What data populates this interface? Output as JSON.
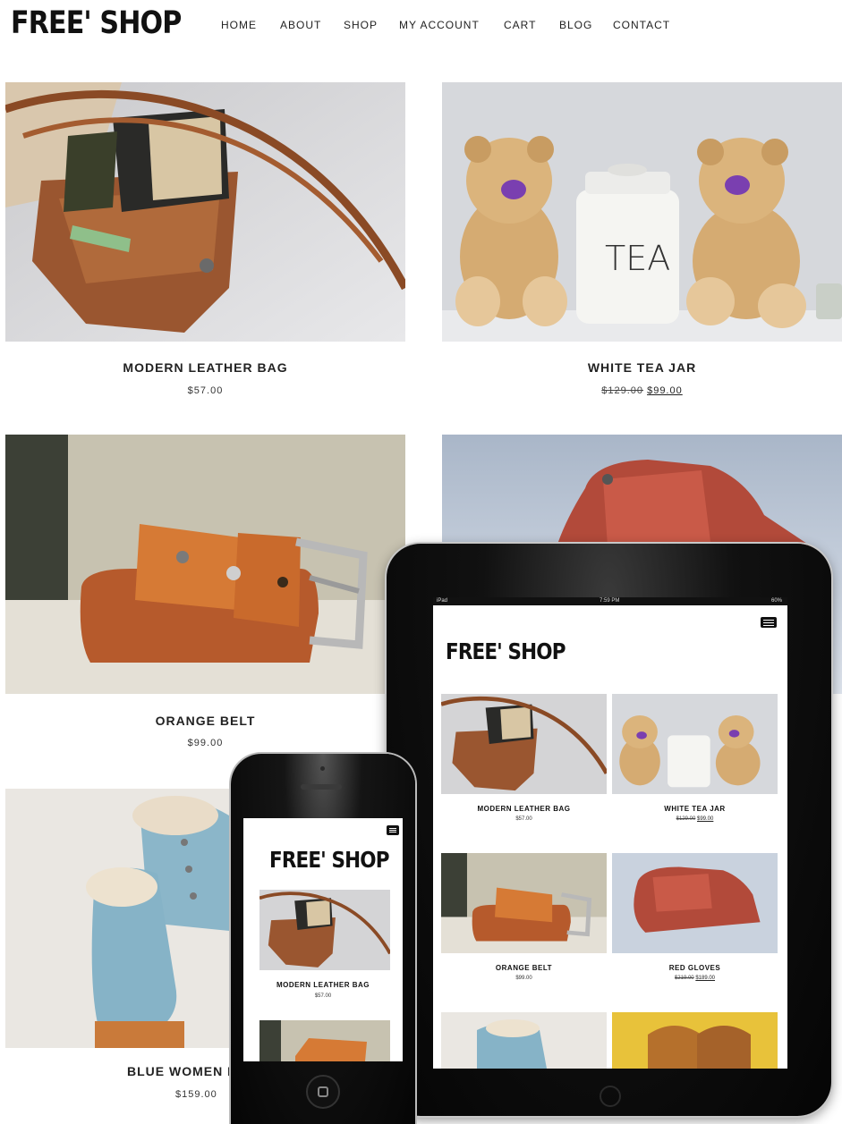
{
  "site": {
    "logo": "FREE' SHOP",
    "nav": [
      "HOME",
      "ABOUT",
      "SHOP",
      "MY ACCOUNT",
      "CART",
      "BLOG",
      "CONTACT"
    ]
  },
  "products": [
    {
      "title": "MODERN LEATHER BAG",
      "price": "$57.00"
    },
    {
      "title": "WHITE TEA JAR",
      "old_price": "$129.00",
      "price": "$99.00"
    },
    {
      "title": "ORANGE BELT",
      "price": "$99.00"
    },
    {
      "title": "BLUE WOMEN B",
      "price": "$159.00"
    }
  ],
  "tablet": {
    "status_left": "iPad",
    "status_time": "7:59 PM",
    "status_right": "60%",
    "logo": "FREE' SHOP",
    "products": [
      {
        "title": "MODERN LEATHER BAG",
        "price": "$57.00"
      },
      {
        "title": "WHITE TEA JAR",
        "old_price": "$129.00",
        "price": "$99.00"
      },
      {
        "title": "ORANGE BELT",
        "price": "$99.00"
      },
      {
        "title": "RED GLOVES",
        "old_price": "$219.00",
        "price": "$189.00"
      }
    ]
  },
  "phone": {
    "logo": "FREE' SHOP",
    "products": [
      {
        "title": "MODERN LEATHER BAG",
        "price": "$57.00"
      }
    ]
  },
  "colors": {
    "text": "#222222",
    "background": "#ffffff",
    "device_body": "#0a0a0a"
  }
}
